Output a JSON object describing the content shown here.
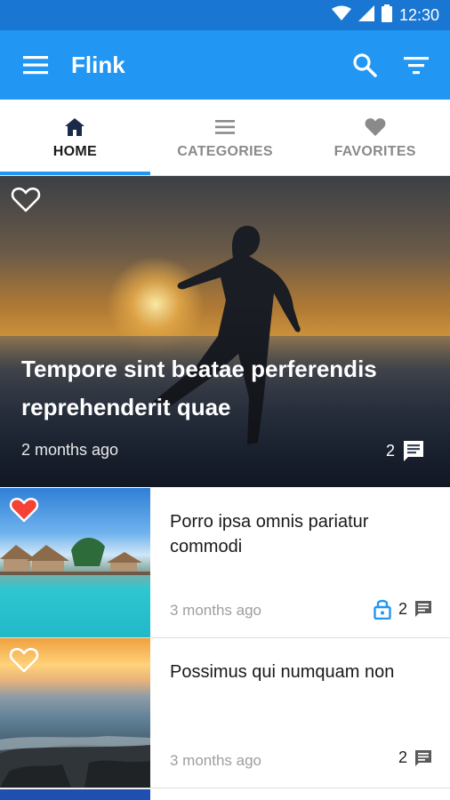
{
  "status_bar": {
    "time": "12:30"
  },
  "app_bar": {
    "title": "Flink"
  },
  "tabs": [
    {
      "label": "HOME",
      "icon": "home-icon",
      "active": true
    },
    {
      "label": "CATEGORIES",
      "icon": "list-icon",
      "active": false
    },
    {
      "label": "FAVORITES",
      "icon": "heart-icon",
      "active": false
    }
  ],
  "featured": {
    "title": "Tempore sint beatae perferendis reprehenderit quae",
    "time": "2 months ago",
    "comments": "2",
    "favorited": false
  },
  "posts": [
    {
      "title": "Porro ipsa omnis pariatur commodi",
      "time": "3 months ago",
      "comments": "2",
      "favorited": true,
      "locked": true
    },
    {
      "title": "Possimus qui numquam non",
      "time": "3 months ago",
      "comments": "2",
      "favorited": false,
      "locked": false
    }
  ],
  "colors": {
    "primary": "#2196f3",
    "status_bar": "#1976d2",
    "favorite": "#f44336",
    "lock": "#2196f3"
  }
}
